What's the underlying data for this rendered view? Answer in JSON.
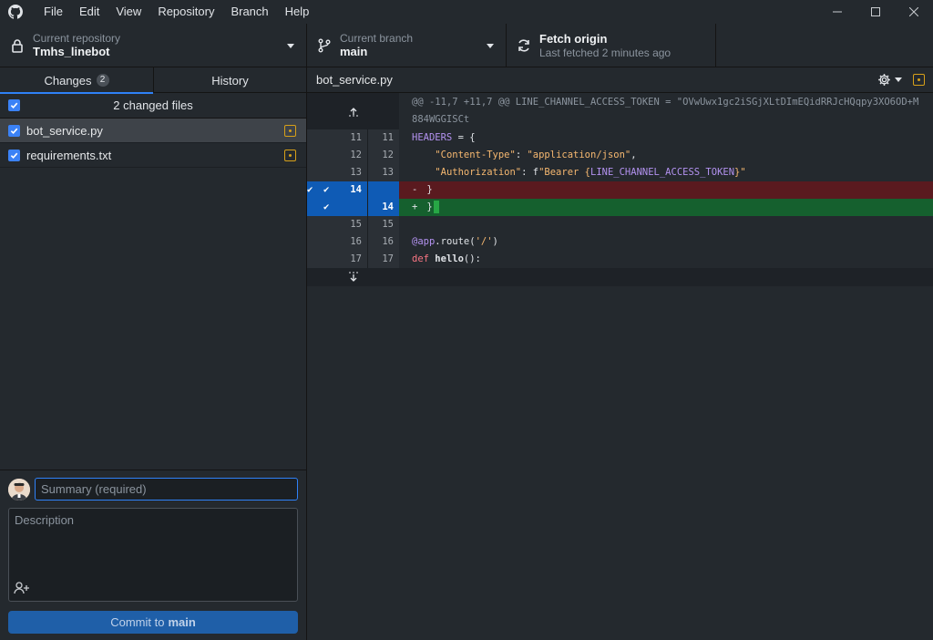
{
  "menu": [
    "File",
    "Edit",
    "View",
    "Repository",
    "Branch",
    "Help"
  ],
  "toolbar": {
    "repo_label": "Current repository",
    "repo_value": "Tmhs_linebot",
    "branch_label": "Current branch",
    "branch_value": "main",
    "fetch_label": "Fetch origin",
    "fetch_sub": "Last fetched 2 minutes ago"
  },
  "tabs": {
    "changes": "Changes",
    "changes_count": "2",
    "history": "History"
  },
  "files": {
    "header": "2 changed files",
    "items": [
      {
        "name": "bot_service.py"
      },
      {
        "name": "requirements.txt"
      }
    ]
  },
  "commit": {
    "summary_placeholder": "Summary (required)",
    "description_placeholder": "Description",
    "button_prefix": "Commit to",
    "button_branch": "main"
  },
  "diff": {
    "file": "bot_service.py",
    "hunk_header": "@@ -11,7 +11,7 @@ LINE_CHANNEL_ACCESS_TOKEN = \"OVwUwx1gc2iSGjXLtDImEQidRRJcHQqpy3XO6OD+M884WGGISCt",
    "lines": [
      {
        "old": "11",
        "new": "11"
      },
      {
        "old": "12",
        "new": "12"
      },
      {
        "old": "13",
        "new": "13"
      },
      {
        "old": "14",
        "new": ""
      },
      {
        "old": "",
        "new": "14"
      },
      {
        "old": "15",
        "new": "15"
      },
      {
        "old": "16",
        "new": "16"
      },
      {
        "old": "17",
        "new": "17"
      }
    ],
    "code": {
      "l11_a": "HEADERS",
      "l11_b": " = {",
      "l12_key": "\"Content-Type\"",
      "l12_sep": ": ",
      "l12_val": "\"application/json\"",
      "l12_end": ",",
      "l13_key": "\"Authorization\"",
      "l13_sep": ": f",
      "l13_val1": "\"Bearer {",
      "l13_var": "LINE_CHANNEL_ACCESS_TOKEN",
      "l13_val2": "}\"",
      "del_sign": "-",
      "del_code": "}",
      "add_sign": "+",
      "add_code": "}",
      "l16_dec": "@app",
      "l16_call": ".route(",
      "l16_str": "'/'",
      "l16_end": ")",
      "l17_kw": "def",
      "l17_fn": "hello",
      "l17_end": "():"
    }
  },
  "colors": {
    "accent": "#2f81f7",
    "modified": "#d7a019",
    "deletion": "#5a1a1f",
    "addition": "#15602e",
    "selected_gutter": "#0f5bb5"
  }
}
